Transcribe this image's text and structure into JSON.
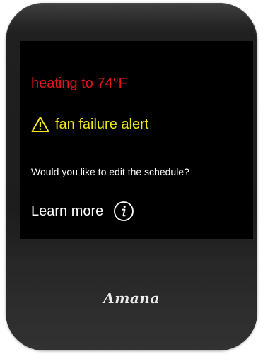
{
  "screen": {
    "status_text": "heating to 74°F",
    "alert_text": "fan failure alert",
    "prompt_text": "Would you like to edit the schedule?",
    "learn_more_label": "Learn more",
    "learn_more_icon": "info-icon",
    "alert_icon": "warning-icon"
  },
  "brand": {
    "logo_text": "Amana"
  },
  "colors": {
    "heating": "#e0151c",
    "alert": "#f0e61a",
    "text": "#ffffff",
    "screen_background": "#000000",
    "bezel": "#1d1d1d"
  }
}
